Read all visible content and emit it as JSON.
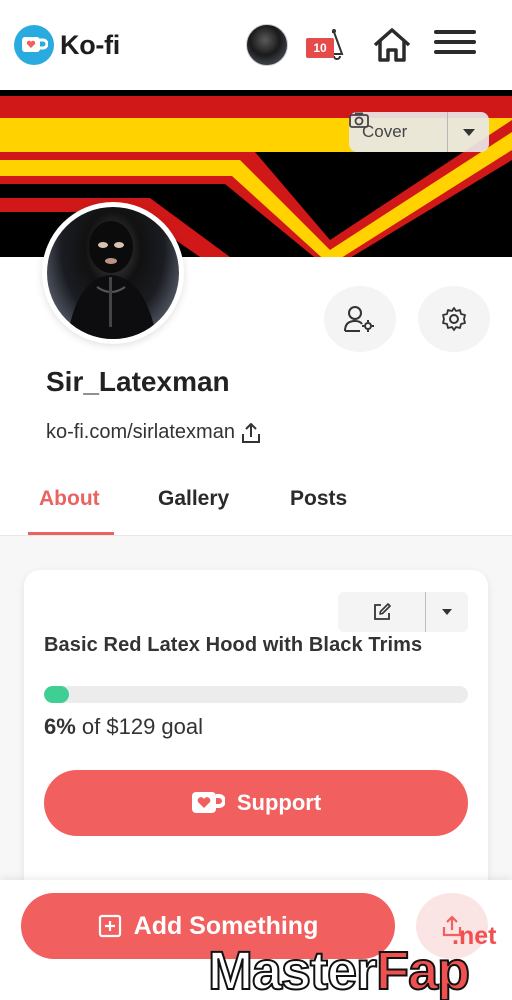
{
  "brand": {
    "name": "Ko-fi",
    "accent": "#f15f5f",
    "logo_blue": "#29abe0"
  },
  "header": {
    "notification_count": "10",
    "icons": [
      "kofi-cup-icon",
      "avatar",
      "bell-icon",
      "home-icon",
      "hamburger-menu-icon"
    ]
  },
  "cover": {
    "button_label": "Cover",
    "colors": [
      "#000000",
      "#ffd200",
      "#d01818"
    ]
  },
  "profile": {
    "username": "Sir_Latexman",
    "url": "ko-fi.com/sirlatexman"
  },
  "tabs": [
    {
      "label": "About",
      "active": true
    },
    {
      "label": "Gallery",
      "active": false
    },
    {
      "label": "Posts",
      "active": false
    }
  ],
  "goal": {
    "title": "Basic Red Latex Hood with Black Trims",
    "percent_label": "6%",
    "goal_suffix": "of $129 goal",
    "progress": 0.06,
    "support_label": "Support",
    "progress_color": "#3fcf94"
  },
  "bottom": {
    "add_label": "Add Something"
  },
  "watermark": {
    "net": ".net",
    "master": "Master",
    "fap": "Fap"
  }
}
